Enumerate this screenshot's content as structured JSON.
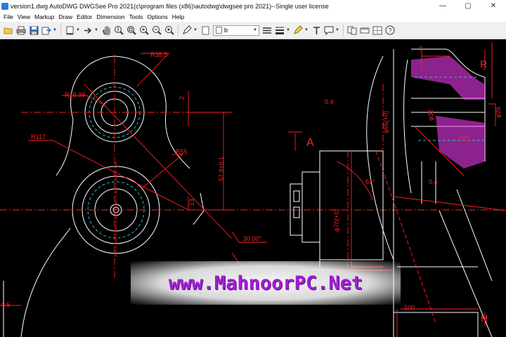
{
  "window": {
    "title": "version1.dwg AutoDWG DWGSee Pro 2021(c\\program files (x86)\\autodwg\\dwgsee pro 2021)--Single user license",
    "controls": {
      "minimize": "—",
      "maximize": "▢",
      "close": "✕"
    }
  },
  "menu": {
    "items": [
      "File",
      "View",
      "Markup",
      "Draw",
      "Editor",
      "Dimension",
      "Tools",
      "Options",
      "Help"
    ]
  },
  "toolbar": {
    "layer_value": "b",
    "icons": [
      "open-folder-icon",
      "print-icon",
      "save-icon",
      "export-icon",
      "page-setup-icon",
      "next-icon",
      "pan-hand-icon",
      "zoom-realtime-icon",
      "zoom-window-icon",
      "zoom-in-icon",
      "zoom-out-icon",
      "zoom-extents-icon",
      "pen-icon",
      "layer-icon",
      "layer-properties-icon",
      "line-style-icon",
      "color-picker-icon",
      "text-icon",
      "comment-icon",
      "compare-icon",
      "measure-icon",
      "object-snap-icon",
      "help-icon"
    ]
  },
  "drawing": {
    "labels": {
      "r385": "R38.5",
      "r1839": "R18.39",
      "r117": "R117",
      "r55": "R55",
      "dim_2": "2",
      "dim_578": "57.8±0.1",
      "dim_13": "13",
      "angle_30": "30.00°",
      "dim_05": "0.5",
      "dim_04a": "0.4",
      "section_a": "A",
      "dim_phi65": "φ65(+0)",
      "dim_phi70": "φ70(+0)",
      "angle_61": "61°",
      "dim_100": "100",
      "dim_phi32": "φ32",
      "dim_04b": "0.4",
      "dim_0": "0",
      "dim_r": "R",
      "r82": "R82",
      "phi26": "φ26",
      "dim_h": "H"
    }
  },
  "watermark": {
    "text": "www.MahnoorPC.Net"
  },
  "colors": {
    "canvas": "#000000",
    "geometry": "#ffffff",
    "dimension": "#ff2020",
    "hidden_line": "#20c0d0",
    "hatch": "#ff40ff",
    "watermark": "#a01ed6"
  }
}
